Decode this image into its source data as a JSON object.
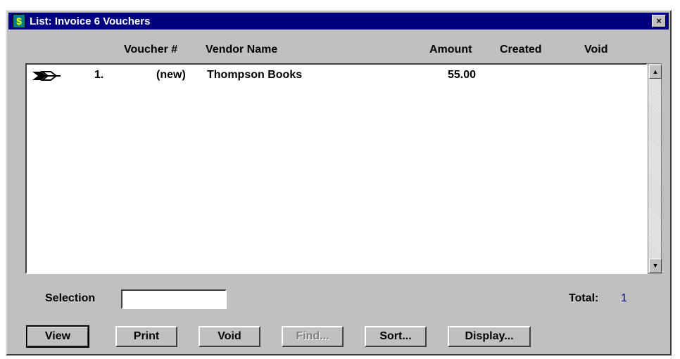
{
  "window": {
    "title": "List: Invoice 6 Vouchers",
    "icon": "$",
    "close": "×"
  },
  "columns": {
    "voucher": "Voucher #",
    "vendor": "Vendor Name",
    "amount": "Amount",
    "created": "Created",
    "void": "Void"
  },
  "rows": [
    {
      "line": "1.",
      "voucher": "(new)",
      "vendor": "Thompson Books",
      "amount": "55.00",
      "created": "",
      "void": ""
    }
  ],
  "selection": {
    "label": "Selection",
    "value": ""
  },
  "total": {
    "label": "Total:",
    "value": "1"
  },
  "buttons": {
    "view": "View",
    "print": "Print",
    "void": "Void",
    "find": "Find...",
    "sort": "Sort...",
    "display": "Display..."
  },
  "scroll": {
    "up": "▲",
    "down": "▼"
  }
}
